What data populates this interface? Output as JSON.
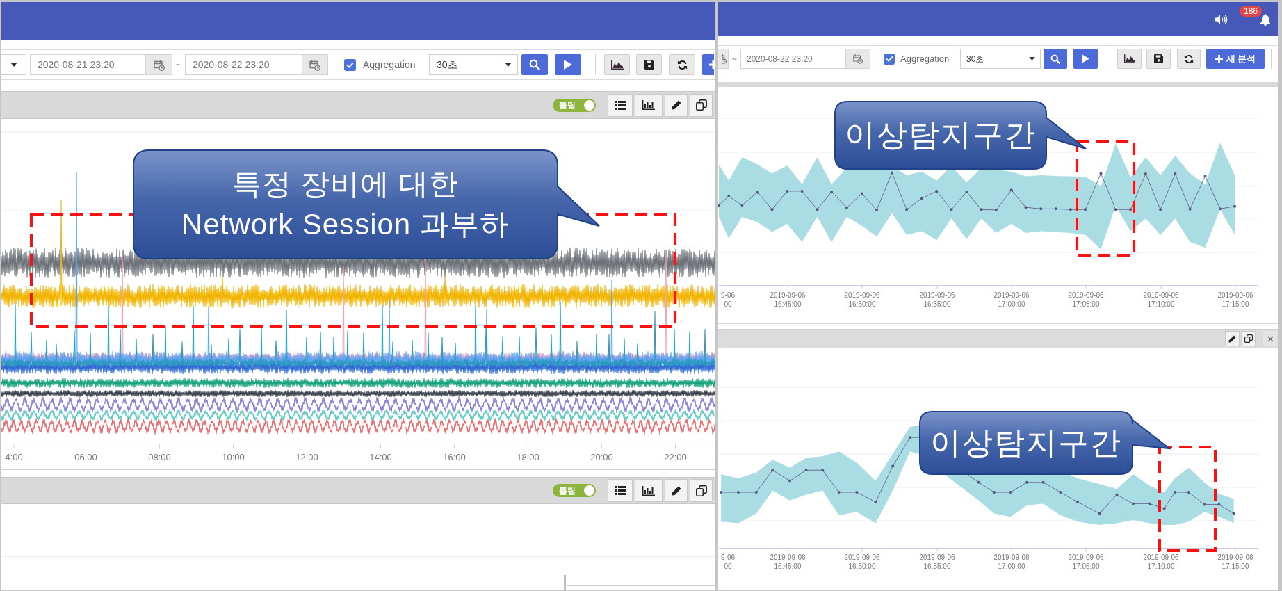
{
  "left_screen": {
    "toolbar": {
      "start_date": "2020-08-21 23:20",
      "range_separator": "~",
      "end_date": "2020-08-22 23:20",
      "aggregation": {
        "label": "Aggregation",
        "checked": true
      },
      "interval": "30초"
    },
    "panels": [
      {
        "tooltip_toggle": {
          "label": "툴팁",
          "on": true
        },
        "x_axis_labels": [
          "4:00",
          "06:00",
          "08:00",
          "10:00",
          "12:00",
          "14:00",
          "16:00",
          "18:00",
          "20:00",
          "22:00"
        ]
      },
      {
        "tooltip_toggle": {
          "label": "툴팁",
          "on": true
        }
      }
    ],
    "callout": {
      "lines": [
        "특정 장비에 대한",
        "Network Session 과부하"
      ]
    }
  },
  "right_screen": {
    "header": {
      "notification_count": "186"
    },
    "toolbar": {
      "range_separator": "~",
      "end_date": "2020-08-22 23:20",
      "aggregation": {
        "label": "Aggregation",
        "checked": true
      },
      "interval": "30초",
      "new_analysis_button": "새 분석"
    },
    "charts": [
      {
        "x_axis_labels": [
          {
            "date": "9-06",
            "time": "00"
          },
          {
            "date": "2019-09-06",
            "time": "16:45:00"
          },
          {
            "date": "2019-09-06",
            "time": "16:50:00"
          },
          {
            "date": "2019-09-06",
            "time": "16:55:00"
          },
          {
            "date": "2019-09-06",
            "time": "17:00:00"
          },
          {
            "date": "2019-09-06",
            "time": "17:05:00"
          },
          {
            "date": "2019-09-06",
            "time": "17:10:00"
          },
          {
            "date": "2019-09-06",
            "time": "17:15:00"
          }
        ],
        "callout": "이상탐지구간"
      },
      {
        "x_axis_labels": [
          {
            "date": "9-06",
            "time": "00"
          },
          {
            "date": "2019-09-06",
            "time": "16:45:00"
          },
          {
            "date": "2019-09-06",
            "time": "16:50:00"
          },
          {
            "date": "2019-09-06",
            "time": "16:55:00"
          },
          {
            "date": "2019-09-06",
            "time": "17:00:00"
          },
          {
            "date": "2019-09-06",
            "time": "17:05:00"
          },
          {
            "date": "2019-09-06",
            "time": "17:10:00"
          },
          {
            "date": "2019-09-06",
            "time": "17:15:00"
          }
        ],
        "callout": "이상탐지구간"
      }
    ]
  }
}
